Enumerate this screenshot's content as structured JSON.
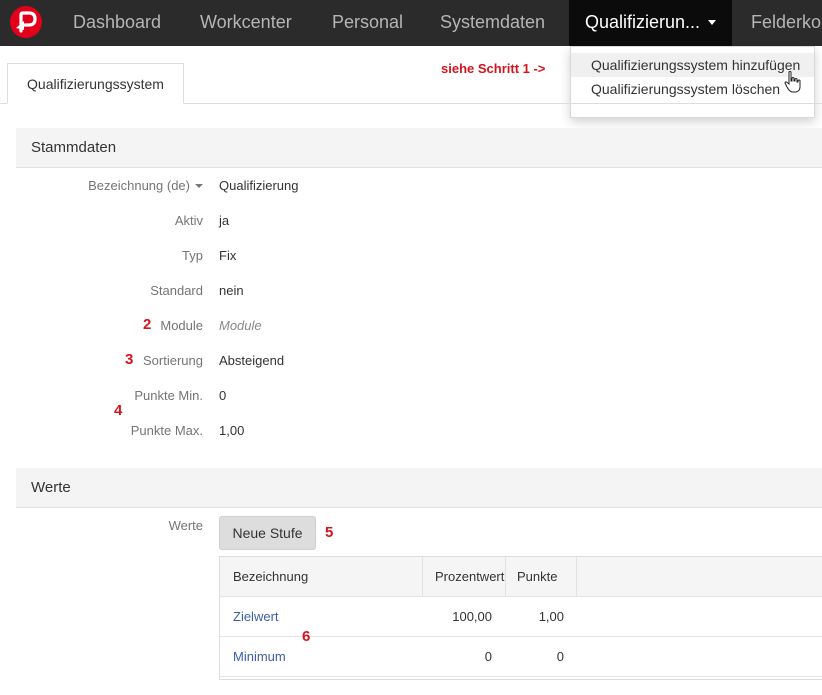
{
  "nav": {
    "items": [
      "Dashboard",
      "Workcenter",
      "Personal",
      "Systemdaten"
    ],
    "active": "Qualifizierun...",
    "overflow": "Felderko"
  },
  "dropdown": {
    "items": [
      "Qualifizierungssystem hinzufügen",
      "Qualifizierungssystem löschen"
    ]
  },
  "annotations": {
    "step1": "siehe Schritt 1 ->",
    "step2": "2",
    "step3": "3",
    "step4": "4",
    "step5": "5",
    "step6": "6"
  },
  "tab": {
    "label": "Qualifizierungssystem"
  },
  "stammdaten": {
    "title": "Stammdaten",
    "fields": [
      {
        "label": "Bezeichnung (de)",
        "value": "Qualifizierung"
      },
      {
        "label": "Aktiv",
        "value": "ja"
      },
      {
        "label": "Typ",
        "value": "Fix"
      },
      {
        "label": "Standard",
        "value": "nein"
      },
      {
        "label": "Module",
        "value": "Module"
      },
      {
        "label": "Sortierung",
        "value": "Absteigend"
      },
      {
        "label": "Punkte Min.",
        "value": "0"
      },
      {
        "label": "Punkte Max.",
        "value": "1,00"
      }
    ]
  },
  "werte": {
    "title": "Werte",
    "field_label": "Werte",
    "button": "Neue Stufe",
    "columns": [
      "Bezeichnung",
      "Prozentwert",
      "Punkte"
    ],
    "rows": [
      {
        "name": "Zielwert",
        "prozent": "100,00",
        "punkte": "1,00"
      },
      {
        "name": "Minimum",
        "prozent": "0",
        "punkte": "0"
      }
    ]
  },
  "colors": {
    "accent": "#d4141e",
    "nav_bg": "#2b2b2b",
    "link": "#3d5da8"
  }
}
